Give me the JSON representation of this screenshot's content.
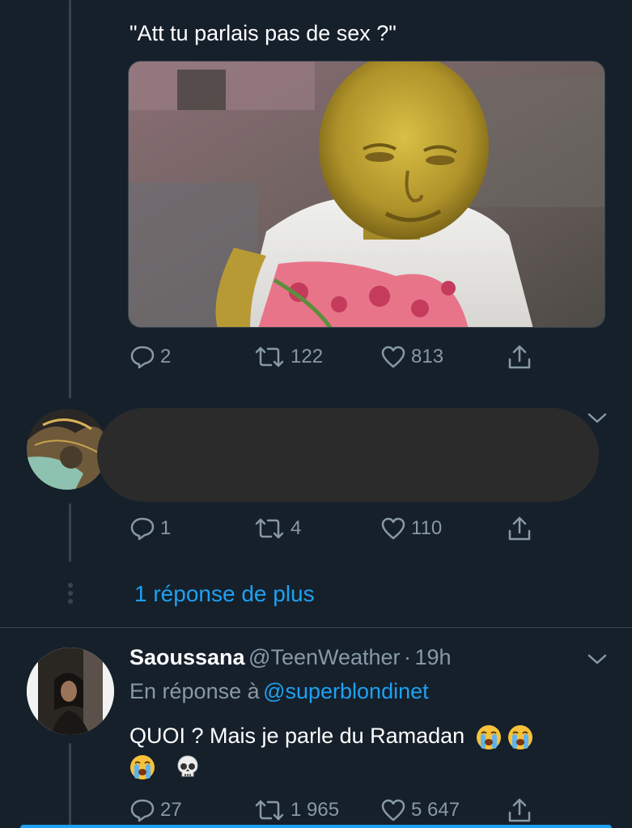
{
  "tweet1": {
    "text": "\"Att tu parlais pas de sex ?\"",
    "media_alt": "photo",
    "actions": {
      "replies": "2",
      "retweets": "122",
      "likes": "813"
    }
  },
  "tweet2": {
    "actions": {
      "replies": "1",
      "retweets": "4",
      "likes": "110"
    }
  },
  "more_replies": {
    "label": "1 réponse de plus"
  },
  "tweet3": {
    "name": "Saoussana",
    "handle": "@TeenWeather",
    "separator": "·",
    "time": "19h",
    "reply_prefix": "En réponse à",
    "reply_to": "@superblondinet",
    "text": "QUOI ? Mais je parle du Ramadan",
    "emojis": [
      "loudly-crying-face",
      "loudly-crying-face",
      "loudly-crying-face",
      "skull"
    ],
    "actions": {
      "replies": "27",
      "retweets": "1 965",
      "likes": "5 647"
    }
  },
  "colors": {
    "background": "#15202b",
    "text": "#ffffff",
    "muted": "#8899a6",
    "accent": "#1da1f2",
    "thread_line": "#38444d"
  }
}
